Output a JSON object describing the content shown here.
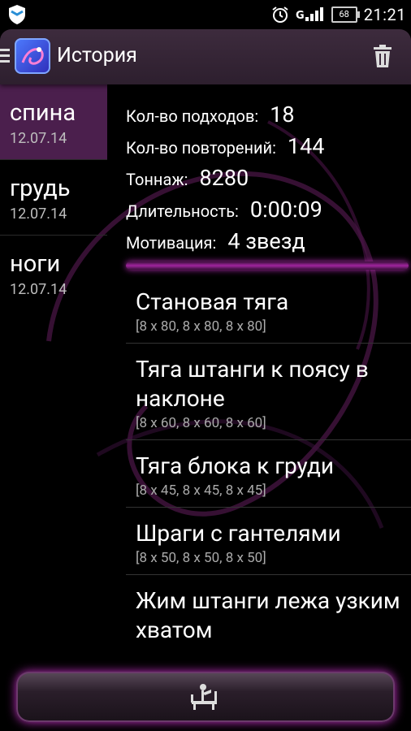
{
  "status_bar": {
    "battery": "68",
    "time": "21:21",
    "icons": [
      "shield-icon",
      "alarm-icon",
      "signal-icon",
      "battery-icon"
    ]
  },
  "action_bar": {
    "title": "История",
    "icons": [
      "menu-icon",
      "app-logo-icon",
      "trash-icon"
    ]
  },
  "days": [
    {
      "name": "спина",
      "date": "12.07.14",
      "selected": true
    },
    {
      "name": "грудь",
      "date": "12.07.14",
      "selected": false
    },
    {
      "name": "ноги",
      "date": "12.07.14",
      "selected": false
    }
  ],
  "stats": [
    {
      "label": "Кол-во подходов:",
      "value": "18"
    },
    {
      "label": "Кол-во повторений:",
      "value": "144"
    },
    {
      "label": "Тоннаж:",
      "value": "8280"
    },
    {
      "label": "Длительность:",
      "value": "0:00:09"
    },
    {
      "label": "Мотивация:",
      "value": "4 звезд"
    }
  ],
  "exercises": [
    {
      "name": "Становая тяга",
      "sets": "[8 x 80, 8 x 80, 8 x 80]"
    },
    {
      "name": "Тяга штанги к поясу в наклоне",
      "sets": "[8 x 60, 8 x 60, 8 x 60]"
    },
    {
      "name": "Тяга блока к груди",
      "sets": "[8 x 45, 8 x 45, 8 x 45]"
    },
    {
      "name": "Шраги с гантелями",
      "sets": "[8 x 50, 8 x 50, 8 x 50]"
    },
    {
      "name": "Жим штанги лежа узким хватом",
      "sets": ""
    }
  ],
  "bottom_bar": {
    "icon": "bench-press-icon"
  },
  "colors": {
    "accent": "#b12ab0",
    "selected_bg": "#4b1f4d",
    "action_bar": "#3d2b3d"
  }
}
